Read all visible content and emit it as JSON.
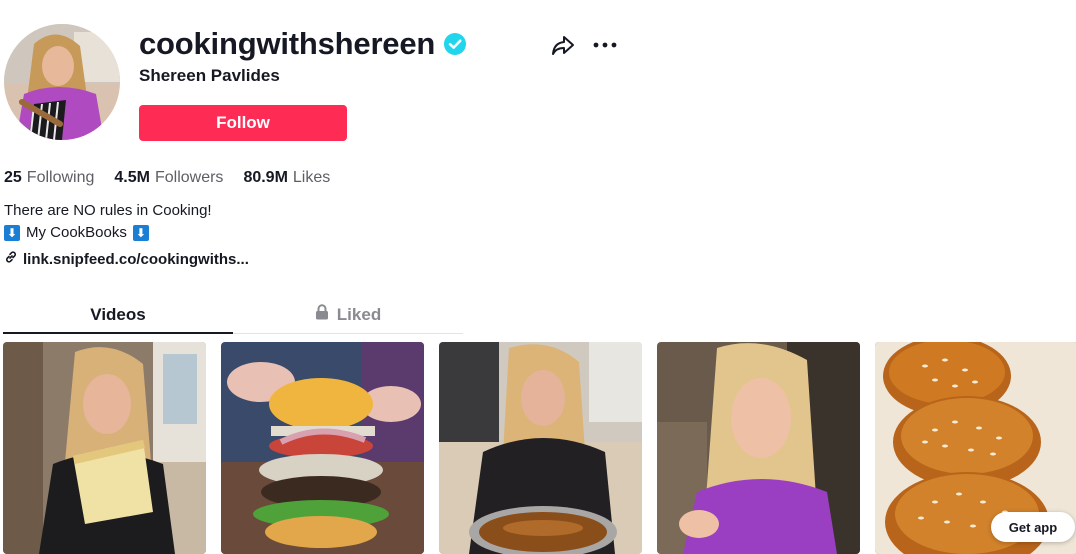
{
  "profile": {
    "username": "cookingwithshereen",
    "nickname": "Shereen Pavlides",
    "follow_label": "Follow",
    "verified": true
  },
  "stats": [
    {
      "value": "25",
      "label": "Following"
    },
    {
      "value": "4.5M",
      "label": "Followers"
    },
    {
      "value": "80.9M",
      "label": "Likes"
    }
  ],
  "bio": {
    "line1": "There are NO rules in Cooking!",
    "line2_text": "My CookBooks",
    "line2_emoji": "⬇"
  },
  "link": {
    "text": "link.snipfeed.co/cookingwiths..."
  },
  "tabs": [
    {
      "label": "Videos",
      "active": true
    },
    {
      "label": "Liked",
      "active": false,
      "locked": true
    }
  ],
  "videos": [
    {
      "subject": "woman holding cheese wedge"
    },
    {
      "subject": "burger with tomato and onions"
    },
    {
      "subject": "woman with skillet of sauce"
    },
    {
      "subject": "woman selfie in purple top"
    },
    {
      "subject": "sesame bread buns"
    }
  ],
  "get_app_label": "Get app",
  "colors": {
    "accent": "#fe2c55",
    "verified": "#20d5ec",
    "text": "#161823",
    "muted": "#5e5e66"
  },
  "icons": [
    "verified-badge-icon",
    "share-icon",
    "more-icon",
    "link-icon",
    "lock-icon"
  ]
}
